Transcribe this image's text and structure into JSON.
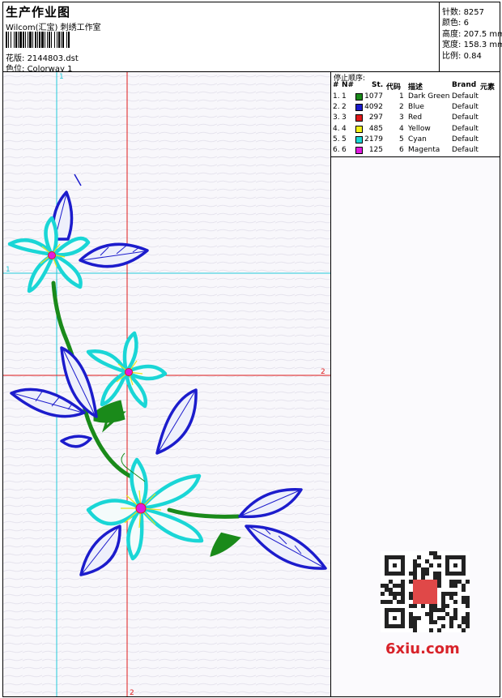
{
  "header": {
    "title": "生产作业图",
    "company": "Wilcom(汇宝) 刺绣工作室",
    "design_label": "花版:",
    "design_value": "2144803.dst",
    "colorway_label": "色位:",
    "colorway_value": "Colorway 1"
  },
  "stats": [
    {
      "label": "针数:",
      "value": "8257"
    },
    {
      "label": "颜色:",
      "value": "6"
    },
    {
      "label": "高度:",
      "value": "207.5 mm"
    },
    {
      "label": "宽度:",
      "value": "158.3 mm"
    },
    {
      "label": "比例:",
      "value": "0.84"
    }
  ],
  "table": {
    "stop_sequence_label": "停止顺序:",
    "columns": [
      "#",
      "N#",
      "St.",
      "代码",
      "描述",
      "Brand",
      "元素"
    ],
    "rows": [
      {
        "idx": "1.",
        "n": "1",
        "stitches": "1077",
        "code": "1",
        "desc": "Dark Green",
        "brand": "Default",
        "color": "#1a8a1a"
      },
      {
        "idx": "2.",
        "n": "2",
        "stitches": "4092",
        "code": "2",
        "desc": "Blue",
        "brand": "Default",
        "color": "#1c1ccc"
      },
      {
        "idx": "3.",
        "n": "3",
        "stitches": "297",
        "code": "3",
        "desc": "Red",
        "brand": "Default",
        "color": "#e01a1a"
      },
      {
        "idx": "4.",
        "n": "4",
        "stitches": "485",
        "code": "4",
        "desc": "Yellow",
        "brand": "Default",
        "color": "#f2f21a"
      },
      {
        "idx": "5.",
        "n": "5",
        "stitches": "2179",
        "code": "5",
        "desc": "Cyan",
        "brand": "Default",
        "color": "#1ad6d6"
      },
      {
        "idx": "6.",
        "n": "6",
        "stitches": "125",
        "code": "6",
        "desc": "Magenta",
        "brand": "Default",
        "color": "#e01ae0"
      }
    ]
  },
  "guides": {
    "cyan_v": "1",
    "cyan_h": "1",
    "red_h": "2",
    "red_v": "2"
  },
  "watermark": "6xiu.com"
}
